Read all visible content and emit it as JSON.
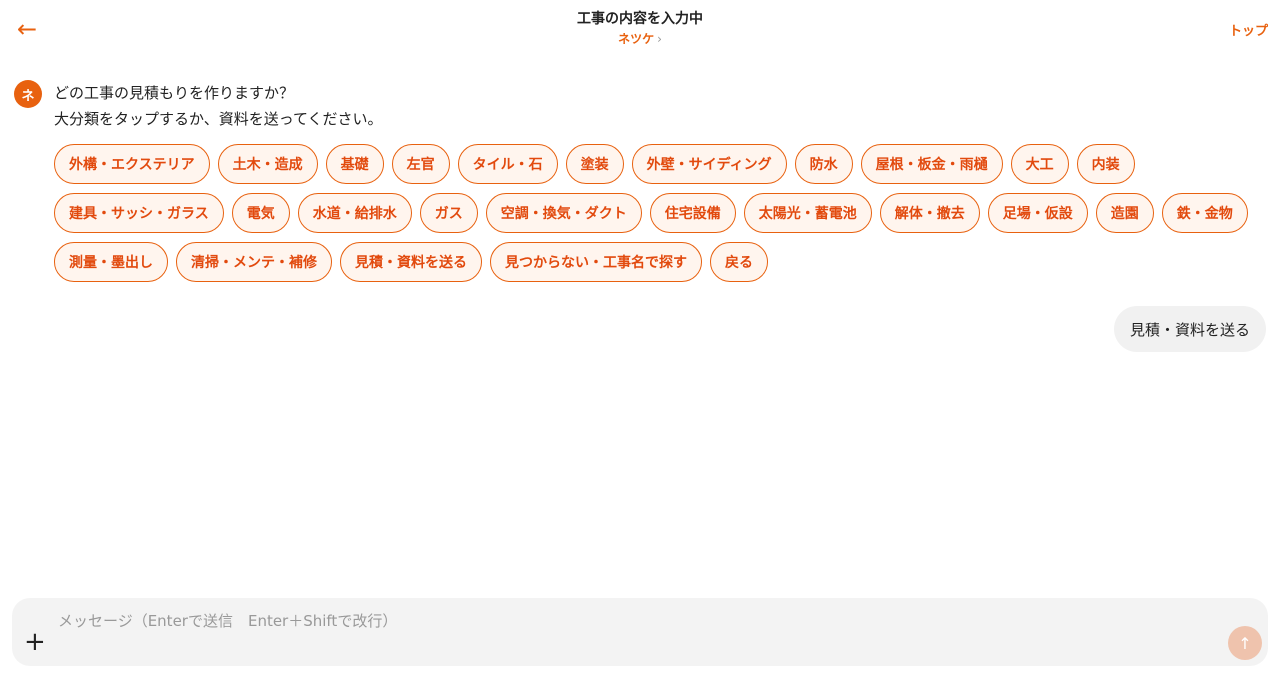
{
  "header": {
    "back_icon": "←",
    "title": "工事の内容を入力中",
    "subtitle": "ネツケ",
    "subtitle_chevron": "›",
    "top_link": "トップ"
  },
  "bot": {
    "avatar": "ネ",
    "line1": "どの工事の見積もりを作りますか？",
    "line2": "大分類をタップするか、資料を送ってください。",
    "chips": [
      "外構・エクステリア",
      "土木・造成",
      "基礎",
      "左官",
      "タイル・石",
      "塗装",
      "外壁・サイディング",
      "防水",
      "屋根・板金・雨樋",
      "大工",
      "内装",
      "建具・サッシ・ガラス",
      "電気",
      "水道・給排水",
      "ガス",
      "空調・換気・ダクト",
      "住宅設備",
      "太陽光・蓄電池",
      "解体・撤去",
      "足場・仮設",
      "造園",
      "鉄・金物",
      "測量・墨出し",
      "清掃・メンテ・補修",
      "見積・資料を送る",
      "見つからない・工事名で探す",
      "戻る"
    ]
  },
  "user": {
    "message": "見積・資料を送る"
  },
  "composer": {
    "placeholder": "メッセージ（Enterで送信　Enter＋Shiftで改行）",
    "plus_icon": "+",
    "send_icon": "↑"
  },
  "colors": {
    "accent": "#e8610f",
    "chip_bg": "#fff5ee",
    "send_disabled": "#efc3ad",
    "bubble_bg": "#f1f1f1"
  }
}
